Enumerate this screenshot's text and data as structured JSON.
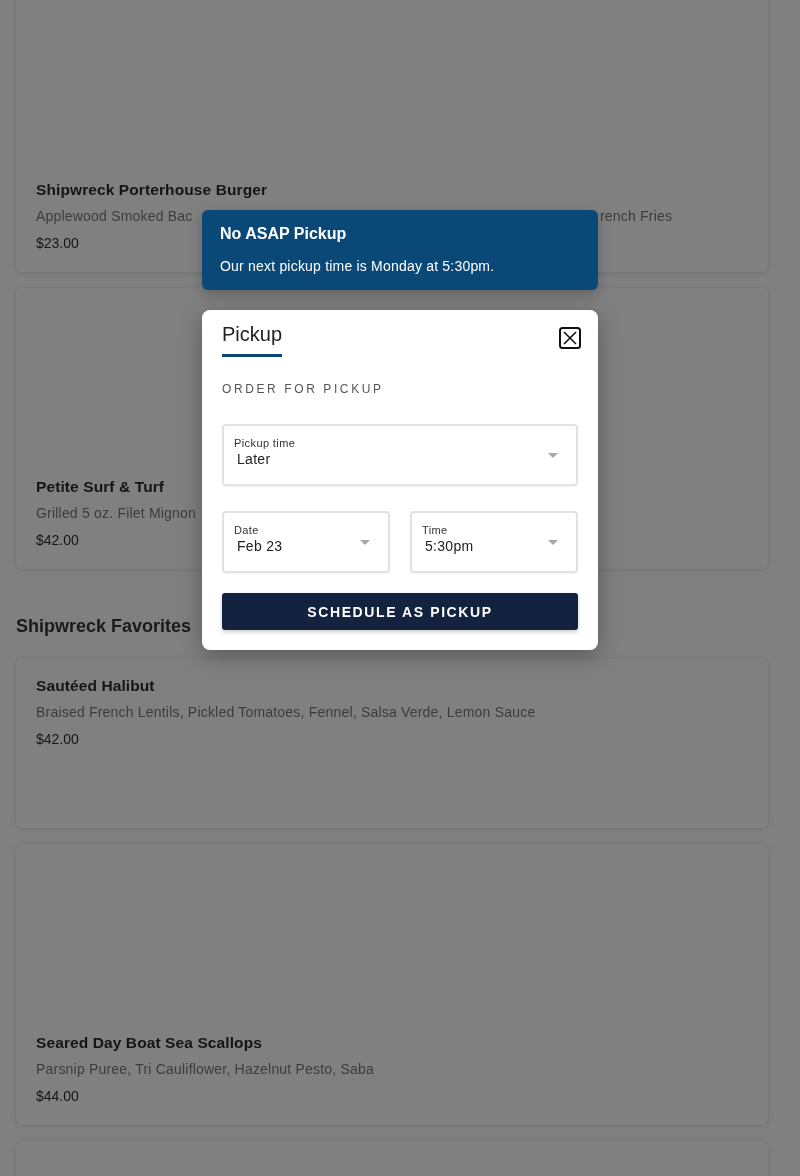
{
  "menu": {
    "sections": [
      {
        "items": [
          {
            "kind": "tall",
            "name": "Shipwreck Porterhouse Burger",
            "description": "Applewood Smoked Bac",
            "description_after_banner": "rench Fries",
            "price": "$23.00"
          },
          {
            "kind": "tall",
            "name": "Petite Surf & Turf",
            "description": "Grilled 5 oz. Filet Mignon",
            "price": "$42.00"
          }
        ]
      },
      {
        "title": "Shipwreck Favorites",
        "items": [
          {
            "kind": "short",
            "name": "Sautéed Halibut",
            "description": "Braised French Lentils, Pickled Tomatoes, Fennel, Salsa Verde, Lemon Sauce",
            "price": "$42.00"
          },
          {
            "kind": "tall",
            "name": "Seared Day Boat Sea Scallops",
            "description": "Parsnip Puree, Tri Cauliflower, Hazelnut Pesto, Saba",
            "price": "$44.00"
          },
          {
            "kind": "cut"
          }
        ]
      }
    ]
  },
  "notice": {
    "title": "No ASAP Pickup",
    "message": "Our next pickup time is Monday at 5:30pm."
  },
  "dialog": {
    "tabs": [
      {
        "label": "Pickup",
        "selected": true
      }
    ],
    "section_label": "ORDER FOR PICKUP",
    "field_rows": [
      [
        {
          "label": "Pickup time",
          "value": "Later"
        }
      ],
      [
        {
          "label": "Date",
          "value": "Feb 23"
        },
        {
          "label": "Time",
          "value": "5:30pm"
        }
      ]
    ],
    "button": "SCHEDULE AS PICKUP"
  }
}
